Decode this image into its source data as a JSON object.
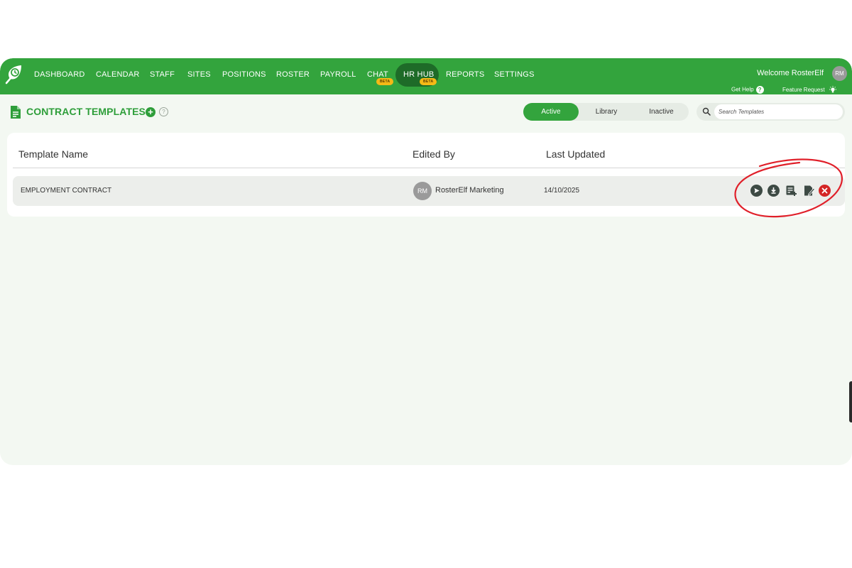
{
  "nav": {
    "items": [
      {
        "label": "DASHBOARD"
      },
      {
        "label": "CALENDAR"
      },
      {
        "label": "STAFF"
      },
      {
        "label": "SITES"
      },
      {
        "label": "POSITIONS"
      },
      {
        "label": "ROSTER"
      },
      {
        "label": "PAYROLL"
      },
      {
        "label": "CHAT",
        "badge": "BETA"
      },
      {
        "label": "HR HUB",
        "badge": "BETA",
        "active": true
      },
      {
        "label": "REPORTS"
      },
      {
        "label": "SETTINGS"
      }
    ]
  },
  "user": {
    "welcome": "Welcome RosterElf",
    "initials": "RM",
    "get_help": "Get Help",
    "feature_request": "Feature Request"
  },
  "page": {
    "title": "CONTRACT TEMPLATES",
    "add_symbol": "+",
    "info_symbol": "?",
    "filters": [
      "Active",
      "Library",
      "Inactive"
    ],
    "active_filter": "Active",
    "search_placeholder": "Search Templates"
  },
  "table": {
    "columns": {
      "name": "Template Name",
      "edited_by": "Edited By",
      "last_updated": "Last Updated"
    },
    "rows": [
      {
        "name": "EMPLOYMENT CONTRACT",
        "editor_initials": "RM",
        "editor": "RosterElf Marketing",
        "updated": "14/10/2025",
        "actions": [
          "send-icon",
          "download-icon",
          "add-document-icon",
          "edit-icon",
          "delete-icon"
        ]
      }
    ]
  },
  "colors": {
    "brand": "#33a43d",
    "brand_dark": "#1e6b28",
    "badge": "#f5b916",
    "annotation": "#e0202a",
    "delete": "#d42525"
  }
}
